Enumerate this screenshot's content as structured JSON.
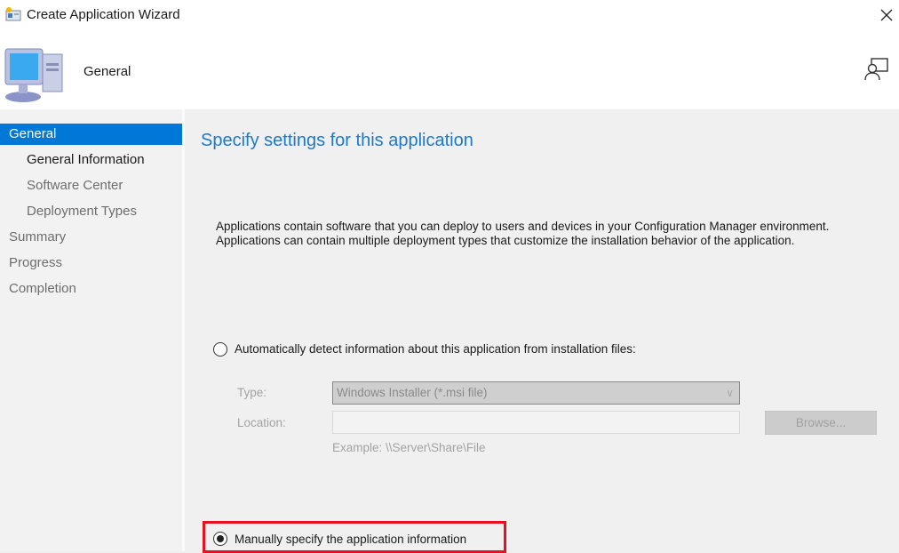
{
  "window": {
    "title": "Create Application Wizard",
    "icons": {
      "app": "wizard-app-icon",
      "close": "close-icon",
      "help": "feedback-person-icon",
      "header": "computer-icon"
    }
  },
  "header": {
    "title": "General"
  },
  "sidebar": {
    "items": [
      {
        "label": "General",
        "selected": true
      },
      {
        "label": "General Information",
        "sub": true,
        "current": true
      },
      {
        "label": "Software Center",
        "sub": true
      },
      {
        "label": "Deployment Types",
        "sub": true
      },
      {
        "label": "Summary"
      },
      {
        "label": "Progress"
      },
      {
        "label": "Completion"
      }
    ]
  },
  "main": {
    "heading": "Specify settings for this application",
    "description_line1": "Applications contain software that you can deploy to users and devices in your Configuration Manager environment.",
    "description_line2": "Applications can contain multiple deployment types that customize the installation behavior of the application.",
    "auto_option": {
      "label": "Automatically detect information about this application from installation files:",
      "selected": false
    },
    "type_label": "Type:",
    "type_value": "Windows Installer (*.msi file)",
    "location_label": "Location:",
    "location_value": "",
    "browse_label": "Browse...",
    "example": "Example: \\\\Server\\Share\\File",
    "manual_option": {
      "label": "Manually specify the application information",
      "selected": true
    }
  },
  "colors": {
    "accent": "#0078d7",
    "heading": "#1e79c9",
    "highlight_box": "#e81123"
  }
}
